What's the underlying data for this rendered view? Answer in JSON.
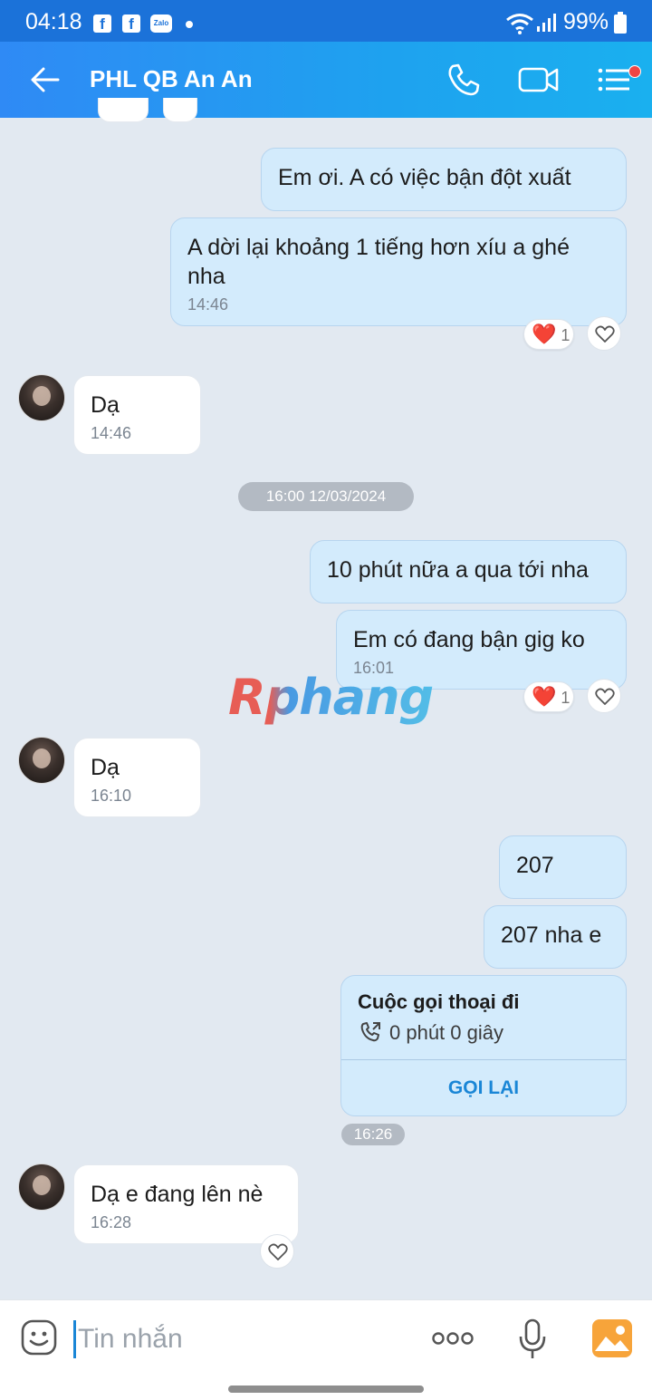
{
  "status_bar": {
    "time": "04:18",
    "battery": "99%",
    "fb1": "f",
    "fb2": "f",
    "zalo": "Zalo"
  },
  "header": {
    "title": "PHL QB An An"
  },
  "messages": [
    {
      "sender": "me",
      "text": "Em ơi. A có việc bận đột xuất"
    },
    {
      "sender": "me",
      "text": "A dời lại khoảng 1 tiếng hơn xíu a ghé nha",
      "time": "14:46",
      "reaction": "❤️",
      "reaction_count": "1"
    },
    {
      "sender": "them",
      "text": "Dạ",
      "time": "14:46"
    },
    {
      "sender": "me",
      "text": "10 phút nữa a qua tới nha"
    },
    {
      "sender": "me",
      "text": "Em có đang bận gig ko",
      "time": "16:01",
      "reaction": "❤️",
      "reaction_count": "1"
    },
    {
      "sender": "them",
      "text": "Dạ",
      "time": "16:10"
    },
    {
      "sender": "me",
      "text": "207"
    },
    {
      "sender": "me",
      "text": "207 nha e"
    },
    {
      "sender": "them",
      "text": "Dạ e đang lên nè",
      "time": "16:28"
    }
  ],
  "date_separator": "16:00 12/03/2024",
  "call": {
    "title": "Cuộc gọi thoại đi",
    "duration": "0 phút 0 giây",
    "action": "GỌI LẠI",
    "time": "16:26"
  },
  "watermark": "Rphang",
  "input": {
    "placeholder": "Tin nhắn"
  },
  "icons": {
    "back": "arrow-left",
    "call": "phone",
    "video": "video-camera",
    "menu": "list",
    "sticker": "emoji-face",
    "more": "more-dots",
    "mic": "microphone",
    "image": "image-gallery",
    "like": "heart-outline"
  },
  "colors": {
    "header": "#1ea2ef",
    "my_bubble": "#d3ebfc",
    "their_bubble": "#ffffff",
    "background": "#e2e9f1",
    "link": "#1a86d6"
  }
}
